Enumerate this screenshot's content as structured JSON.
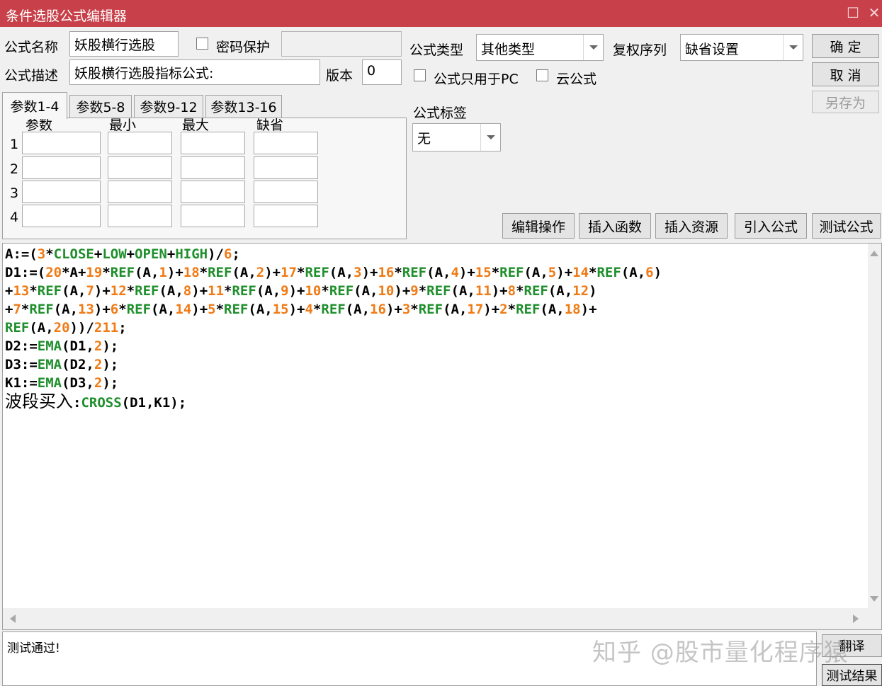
{
  "window": {
    "title": "条件选股公式编辑器",
    "maximize_glyph": "☐",
    "close_glyph": "✕"
  },
  "form": {
    "name_label": "公式名称",
    "name_value": "妖股横行选股",
    "password_label": "密码保护",
    "desc_label": "公式描述",
    "desc_value": "妖股横行选股指标公式:",
    "version_label": "版本",
    "version_value": "0",
    "type_label": "公式类型",
    "type_value": "其他类型",
    "fuquan_label": "复权序列",
    "fuquan_value": "缺省设置",
    "pc_only_label": "公式只用于PC",
    "cloud_label": "云公式",
    "tag_label": "公式标签",
    "tag_value": "无"
  },
  "buttons": {
    "confirm": "确  定",
    "cancel": "取  消",
    "save_as": "另存为",
    "edit_ops": "编辑操作",
    "insert_func": "插入函数",
    "insert_res": "插入资源",
    "import_formula": "引入公式",
    "test_formula": "测试公式",
    "translate": "翻译",
    "test_result": "测试结果"
  },
  "tabs": [
    "参数1-4",
    "参数5-8",
    "参数9-12",
    "参数13-16"
  ],
  "params": {
    "headers": [
      "参数",
      "最小",
      "最大",
      "缺省"
    ],
    "rows": [
      "1",
      "2",
      "3",
      "4"
    ]
  },
  "editor": {
    "lines": [
      [
        [
          "t",
          "A:=("
        ],
        [
          "n",
          "3"
        ],
        [
          "t",
          "*"
        ],
        [
          "k",
          "CLOSE"
        ],
        [
          "t",
          "+"
        ],
        [
          "k",
          "LOW"
        ],
        [
          "t",
          "+"
        ],
        [
          "k",
          "OPEN"
        ],
        [
          "t",
          "+"
        ],
        [
          "k",
          "HIGH"
        ],
        [
          "t",
          ")/"
        ],
        [
          "n",
          "6"
        ],
        [
          "t",
          ";"
        ]
      ],
      [
        [
          "t",
          "D1:=("
        ],
        [
          "n",
          "20"
        ],
        [
          "t",
          "*A+"
        ],
        [
          "n",
          "19"
        ],
        [
          "t",
          "*"
        ],
        [
          "k",
          "REF"
        ],
        [
          "t",
          "(A,"
        ],
        [
          "n",
          "1"
        ],
        [
          "t",
          ")+"
        ],
        [
          "n",
          "18"
        ],
        [
          "t",
          "*"
        ],
        [
          "k",
          "REF"
        ],
        [
          "t",
          "(A,"
        ],
        [
          "n",
          "2"
        ],
        [
          "t",
          ")+"
        ],
        [
          "n",
          "17"
        ],
        [
          "t",
          "*"
        ],
        [
          "k",
          "REF"
        ],
        [
          "t",
          "(A,"
        ],
        [
          "n",
          "3"
        ],
        [
          "t",
          ")+"
        ],
        [
          "n",
          "16"
        ],
        [
          "t",
          "*"
        ],
        [
          "k",
          "REF"
        ],
        [
          "t",
          "(A,"
        ],
        [
          "n",
          "4"
        ],
        [
          "t",
          ")+"
        ],
        [
          "n",
          "15"
        ],
        [
          "t",
          "*"
        ],
        [
          "k",
          "REF"
        ],
        [
          "t",
          "(A,"
        ],
        [
          "n",
          "5"
        ],
        [
          "t",
          ")+"
        ],
        [
          "n",
          "14"
        ],
        [
          "t",
          "*"
        ],
        [
          "k",
          "REF"
        ],
        [
          "t",
          "(A,"
        ],
        [
          "n",
          "6"
        ],
        [
          "t",
          ")"
        ]
      ],
      [
        [
          "t",
          "+"
        ],
        [
          "n",
          "13"
        ],
        [
          "t",
          "*"
        ],
        [
          "k",
          "REF"
        ],
        [
          "t",
          "(A,"
        ],
        [
          "n",
          "7"
        ],
        [
          "t",
          ")+"
        ],
        [
          "n",
          "12"
        ],
        [
          "t",
          "*"
        ],
        [
          "k",
          "REF"
        ],
        [
          "t",
          "(A,"
        ],
        [
          "n",
          "8"
        ],
        [
          "t",
          ")+"
        ],
        [
          "n",
          "11"
        ],
        [
          "t",
          "*"
        ],
        [
          "k",
          "REF"
        ],
        [
          "t",
          "(A,"
        ],
        [
          "n",
          "9"
        ],
        [
          "t",
          ")+"
        ],
        [
          "n",
          "10"
        ],
        [
          "t",
          "*"
        ],
        [
          "k",
          "REF"
        ],
        [
          "t",
          "(A,"
        ],
        [
          "n",
          "10"
        ],
        [
          "t",
          ")+"
        ],
        [
          "n",
          "9"
        ],
        [
          "t",
          "*"
        ],
        [
          "k",
          "REF"
        ],
        [
          "t",
          "(A,"
        ],
        [
          "n",
          "11"
        ],
        [
          "t",
          ")+"
        ],
        [
          "n",
          "8"
        ],
        [
          "t",
          "*"
        ],
        [
          "k",
          "REF"
        ],
        [
          "t",
          "(A,"
        ],
        [
          "n",
          "12"
        ],
        [
          "t",
          ")"
        ]
      ],
      [
        [
          "t",
          "+"
        ],
        [
          "n",
          "7"
        ],
        [
          "t",
          "*"
        ],
        [
          "k",
          "REF"
        ],
        [
          "t",
          "(A,"
        ],
        [
          "n",
          "13"
        ],
        [
          "t",
          ")+"
        ],
        [
          "n",
          "6"
        ],
        [
          "t",
          "*"
        ],
        [
          "k",
          "REF"
        ],
        [
          "t",
          "(A,"
        ],
        [
          "n",
          "14"
        ],
        [
          "t",
          ")+"
        ],
        [
          "n",
          "5"
        ],
        [
          "t",
          "*"
        ],
        [
          "k",
          "REF"
        ],
        [
          "t",
          "(A,"
        ],
        [
          "n",
          "15"
        ],
        [
          "t",
          ")+"
        ],
        [
          "n",
          "4"
        ],
        [
          "t",
          "*"
        ],
        [
          "k",
          "REF"
        ],
        [
          "t",
          "(A,"
        ],
        [
          "n",
          "16"
        ],
        [
          "t",
          ")+"
        ],
        [
          "n",
          "3"
        ],
        [
          "t",
          "*"
        ],
        [
          "k",
          "REF"
        ],
        [
          "t",
          "(A,"
        ],
        [
          "n",
          "17"
        ],
        [
          "t",
          ")+"
        ],
        [
          "n",
          "2"
        ],
        [
          "t",
          "*"
        ],
        [
          "k",
          "REF"
        ],
        [
          "t",
          "(A,"
        ],
        [
          "n",
          "18"
        ],
        [
          "t",
          ")+"
        ]
      ],
      [
        [
          "k",
          "REF"
        ],
        [
          "t",
          "(A,"
        ],
        [
          "n",
          "20"
        ],
        [
          "t",
          "))/"
        ],
        [
          "n",
          "211"
        ],
        [
          "t",
          ";"
        ]
      ],
      [
        [
          "t",
          "D2:="
        ],
        [
          "k",
          "EMA"
        ],
        [
          "t",
          "(D1,"
        ],
        [
          "n",
          "2"
        ],
        [
          "t",
          ");"
        ]
      ],
      [
        [
          "t",
          "D3:="
        ],
        [
          "k",
          "EMA"
        ],
        [
          "t",
          "(D2,"
        ],
        [
          "n",
          "2"
        ],
        [
          "t",
          ");"
        ]
      ],
      [
        [
          "t",
          "K1:="
        ],
        [
          "k",
          "EMA"
        ],
        [
          "t",
          "(D3,"
        ],
        [
          "n",
          "2"
        ],
        [
          "t",
          ");"
        ]
      ],
      [
        [
          "cn",
          "波段买入"
        ],
        [
          "t",
          ":"
        ],
        [
          "k",
          "CROSS"
        ],
        [
          "t",
          "(D1,K1);"
        ]
      ]
    ]
  },
  "result": {
    "text": "测试通过!"
  },
  "watermark": "知乎 @股市量化程序猿",
  "colors": {
    "titlebar": "#c8414a",
    "keyword": "#1f8f2c",
    "number": "#f07a14"
  }
}
